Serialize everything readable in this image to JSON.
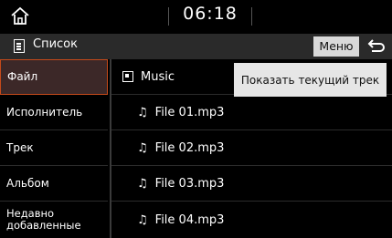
{
  "status": {
    "time": "06:18"
  },
  "header": {
    "title": "Список",
    "menu_label": "Меню"
  },
  "sidebar": {
    "items": [
      {
        "label": "Файл",
        "active": true
      },
      {
        "label": "Исполнитель",
        "active": false
      },
      {
        "label": "Трек",
        "active": false
      },
      {
        "label": "Альбом",
        "active": false
      },
      {
        "label": "Недавно добавленные",
        "active": false
      }
    ]
  },
  "list": {
    "folder": "Music",
    "files": [
      "File 01.mp3",
      "File 02.mp3",
      "File 03.mp3",
      "File 04.mp3"
    ]
  },
  "popup": {
    "label": "Показать текущий трек"
  },
  "icons": {
    "home": "home-icon",
    "list": "list-icon",
    "back": "back-arrow-icon",
    "folder": "folder-icon",
    "music": "music-note-icon"
  }
}
